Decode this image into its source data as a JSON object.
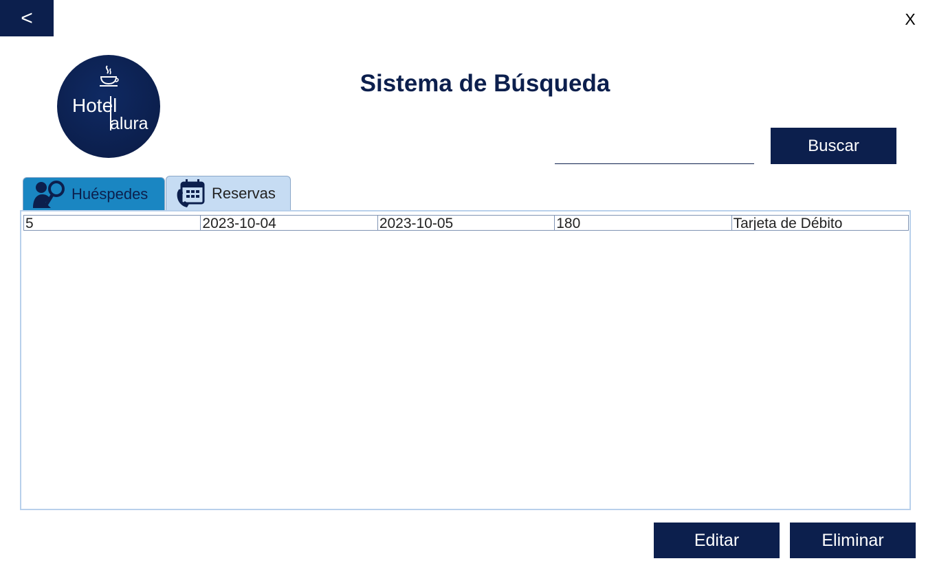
{
  "header": {
    "back_label": "<",
    "close_label": "X",
    "title": "Sistema de Búsqueda"
  },
  "logo": {
    "line1": "Hotel",
    "line2": "alura"
  },
  "search": {
    "value": "",
    "button_label": "Buscar"
  },
  "tabs": [
    {
      "label": "Huéspedes",
      "icon": "search-guest-icon",
      "active": false
    },
    {
      "label": "Reservas",
      "icon": "calendar-phone-icon",
      "active": true
    }
  ],
  "table": {
    "rows": [
      [
        "5",
        "2023-10-04",
        "2023-10-05",
        "180",
        "Tarjeta de Débito"
      ]
    ]
  },
  "actions": {
    "edit_label": "Editar",
    "delete_label": "Eliminar"
  },
  "colors": {
    "brand_navy": "#0c1f4d",
    "tab_blue": "#1a86c2",
    "tab_light": "#c6dcf3"
  }
}
